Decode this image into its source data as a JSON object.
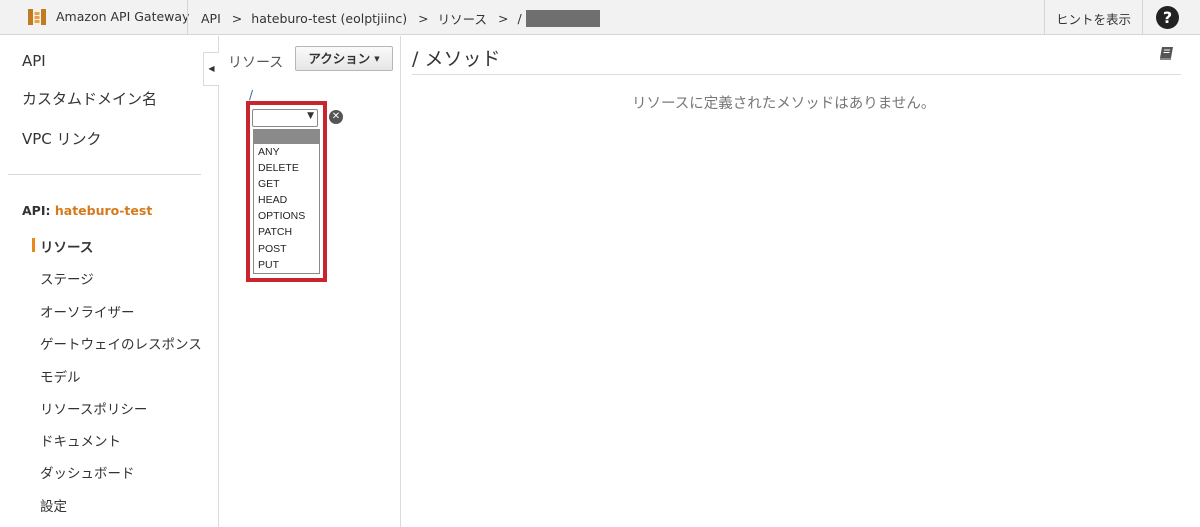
{
  "topbar": {
    "brand": "Amazon API Gateway",
    "breadcrumbs": [
      "API",
      "hateburo-test (eolptjiinc)",
      "リソース",
      "/"
    ],
    "breadcrumb_separator": ">",
    "hint_label": "ヒントを表示",
    "help_label": "?"
  },
  "sidebar": {
    "top_items": [
      {
        "label": "API"
      },
      {
        "label": "カスタムドメイン名"
      },
      {
        "label": "VPC リンク"
      }
    ],
    "api_prefix": "API:",
    "api_name": "hateburo-test",
    "sub_items": [
      {
        "label": "リソース",
        "active": true
      },
      {
        "label": "ステージ"
      },
      {
        "label": "オーソライザー"
      },
      {
        "label": "ゲートウェイのレスポンス"
      },
      {
        "label": "モデル"
      },
      {
        "label": "リソースポリシー"
      },
      {
        "label": "ドキュメント"
      },
      {
        "label": "ダッシュボード"
      },
      {
        "label": "設定"
      }
    ],
    "collapse_glyph": "◀"
  },
  "resources": {
    "label": "リソース",
    "action_button": "アクション",
    "action_caret": "▼",
    "root_path": "/",
    "method_select_value": "",
    "method_options": [
      "",
      "ANY",
      "DELETE",
      "GET",
      "HEAD",
      "OPTIONS",
      "PATCH",
      "POST",
      "PUT"
    ],
    "remove_glyph": "✕"
  },
  "main": {
    "title": "/ メソッド",
    "empty_message": "リソースに定義されたメソッドはありません。"
  },
  "colors": {
    "accent_orange": "#d57a1b",
    "highlight_red": "#c8252f",
    "link_blue": "#2866b5"
  },
  "icons": {
    "logo": "api-gateway-logo-icon",
    "help": "help-circle-icon",
    "book": "book-icon",
    "remove": "remove-circle-icon"
  }
}
